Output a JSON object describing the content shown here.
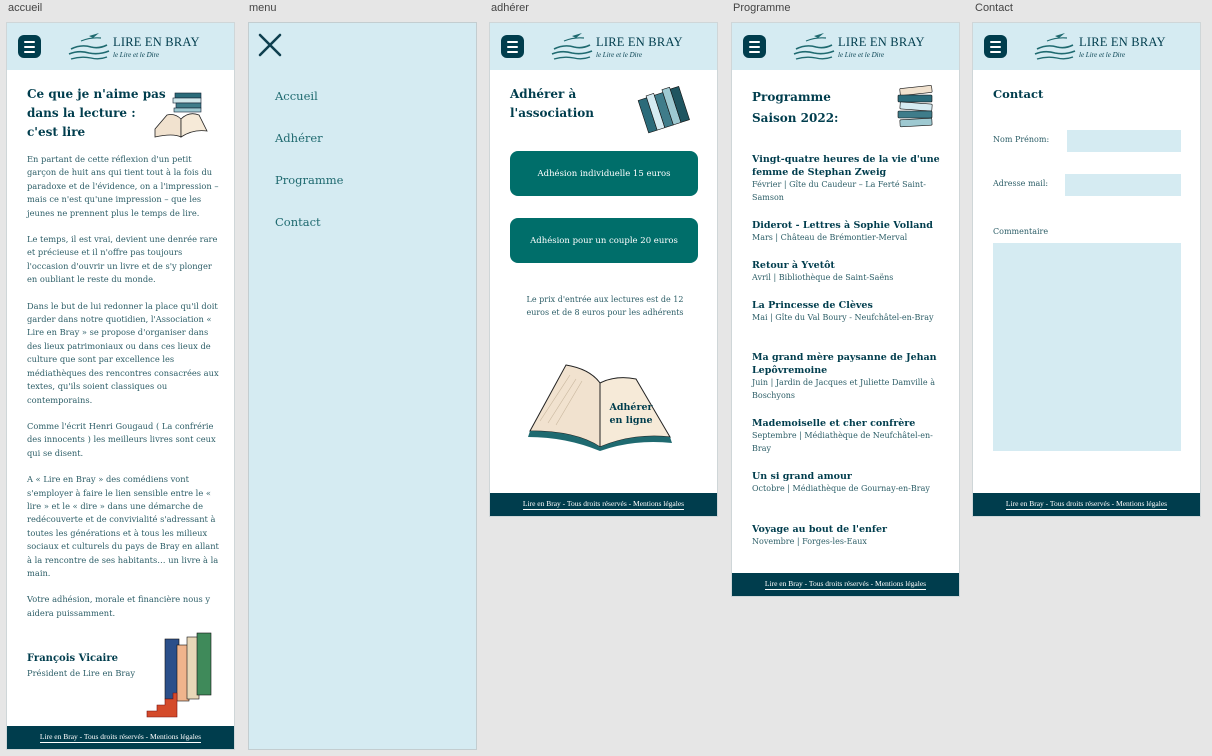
{
  "frames": {
    "accueil": "accueil",
    "menu": "menu",
    "adherer": "adhérer",
    "programme": "Programme",
    "contact": "Contact"
  },
  "brand": {
    "title": "LIRE EN BRAY",
    "subtitle": "le Lire et le Dire"
  },
  "footer": "Lire en Bray - Tous droits réservés - Mentions légales",
  "accueil": {
    "title_l1": "Ce que je n'aime pas",
    "title_l2": "dans la lecture :",
    "title_l3": "c'est lire",
    "p1": "En partant de cette réflexion d'un petit garçon de huit ans qui tient tout à la fois du paradoxe et de l'évidence, on a l'impression – mais ce n'est qu'une impression – que les jeunes ne prennent plus le temps de lire.",
    "p2": "Le temps, il est vrai, devient une denrée rare et précieuse et il n'offre pas toujours l'occasion d'ouvrir un livre et de s'y plonger en oubliant le reste du monde.",
    "p3": "Dans le but de lui redonner la place qu'il doit garder dans notre quotidien, l'Association « Lire en Bray » se propose d'organiser dans des lieux patrimoniaux ou dans ces lieux de culture que sont par excellence les médiathèques des rencontres consacrées aux textes, qu'ils soient classiques ou contemporains.",
    "p4": "Comme l'écrit Henri Gougaud ( La confrérie des innocents ) les meilleurs livres sont ceux qui se disent.",
    "p5": "A « Lire en Bray » des comédiens vont s'employer à faire le lien sensible entre le « lire » et le « dire » dans une démarche de redécouverte et de convivialité s'adressant à toutes les générations et à tous les milieux sociaux et culturels du pays de Bray en allant à la rencontre de ses habitants… un livre à la main.",
    "p6": "Votre adhésion, morale et financière nous y aidera puissamment.",
    "sign": "François Vicaire",
    "role": "Président de Lire en Bray"
  },
  "menu": {
    "items": [
      "Accueil",
      "Adhérer",
      "Programme",
      "Contact"
    ]
  },
  "adherer": {
    "title_l1": "Adhérer à",
    "title_l2": "l'association",
    "btn1": "Adhésion individuelle 15 euros",
    "btn2": "Adhésion pour un couple 20 euros",
    "note": "Le prix d'entrée aux lectures est de 12 euros et de 8 euros pour les adhérents",
    "book_l1": "Adhérer",
    "book_l2": "en ligne"
  },
  "programme": {
    "title_l1": "Programme",
    "title_l2": "Saison 2022:",
    "items": [
      {
        "title": "Vingt-quatre heures de la vie d'une femme de Stephan Zweig",
        "details": "Février | Gîte du Caudeur – La Ferté Saint-Samson"
      },
      {
        "title": "Diderot - Lettres à Sophie Volland",
        "details": "Mars | Château de Brémontier-Merval"
      },
      {
        "title": "Retour à Yvetôt",
        "details": "Avril | Bibliothèque de Saint-Saëns"
      },
      {
        "title": "La Princesse de Clèves",
        "details": "Mai | Gîte du Val Boury - Neufchâtel-en-Bray"
      },
      {
        "title": "Ma grand mère paysanne de Jehan Lepôvremoine",
        "details": "Juin | Jardin de Jacques et Juliette Damville à Boschyons"
      },
      {
        "title": "Mademoiselle et cher confrère",
        "details": "Septembre | Médiathèque de Neufchâtel-en-Bray"
      },
      {
        "title": "Un si grand amour",
        "details": "Octobre | Médiathèque de Gournay-en-Bray"
      },
      {
        "title": "Voyage au bout de l'enfer",
        "details": "Novembre | Forges-les-Eaux"
      }
    ]
  },
  "contact": {
    "title": "Contact",
    "name_label": "Nom Prénom:",
    "email_label": "Adresse mail:",
    "comment_label": "Commentaire"
  },
  "colors": {
    "header_bg": "#d5ebf2",
    "dark_teal": "#003d4d",
    "button_teal": "#006e6a"
  }
}
